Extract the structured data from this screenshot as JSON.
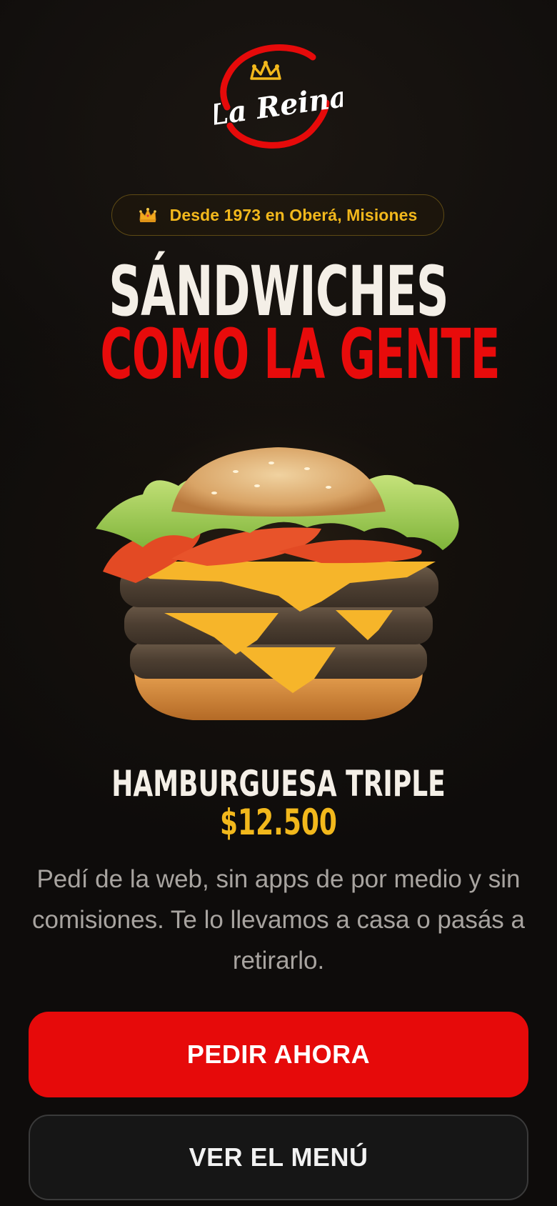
{
  "brand": {
    "logo_text": "La Reina",
    "logo_icon": "crown-logo-icon"
  },
  "since": {
    "icon": "crown-icon",
    "text": "Desde 1973 en Oberá, Misiones"
  },
  "hero": {
    "headline_line1": "SÁNDWICHES",
    "headline_line2": "COMO LA GENTE"
  },
  "product": {
    "image": "burger-image",
    "name": "HAMBURGUESA TRIPLE",
    "price": "$12.500"
  },
  "description": "Pedí de la web, sin apps de por medio y sin comisiones. Te lo llevamos a casa o pasás a retirarlo.",
  "actions": {
    "order_label": "PEDIR AHORA",
    "menu_label": "VER EL MENÚ"
  },
  "colors": {
    "background": "#0e0c0b",
    "accent_red": "#e60a0a",
    "accent_gold": "#f2b81c",
    "text_light": "#f4efe7"
  }
}
